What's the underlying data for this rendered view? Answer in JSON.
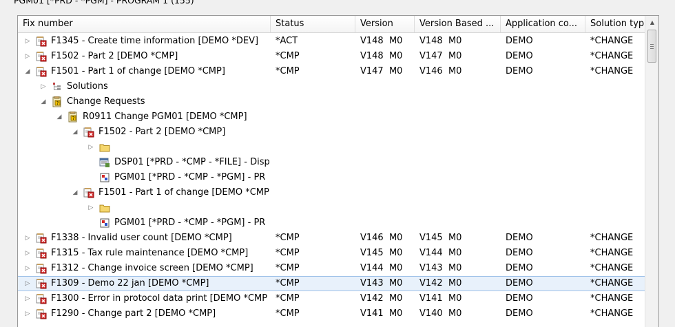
{
  "window": {
    "title": "PGM01 [*PRD - *PGM] - PROGRAM 1 (155)"
  },
  "columns": {
    "fix": "Fix number",
    "status": "Status",
    "version": "Version",
    "based": "Version Based ...",
    "app": "Application co...",
    "sol": "Solution typ"
  },
  "rows": [
    {
      "exp": "right",
      "icon": "fix",
      "indent": 0,
      "name": "F1345 - Create time information [DEMO *DEV]",
      "status": "*ACT",
      "version": "V148  M0",
      "based": "V148  M0",
      "app": "DEMO",
      "sol": "*CHANGE"
    },
    {
      "exp": "right",
      "icon": "fix",
      "indent": 0,
      "name": "F1502 - Part 2 [DEMO *CMP]",
      "status": "*CMP",
      "version": "V148  M0",
      "based": "V147  M0",
      "app": "DEMO",
      "sol": "*CHANGE"
    },
    {
      "exp": "down",
      "icon": "fix",
      "indent": 0,
      "name": "F1501 - Part 1 of change [DEMO *CMP]",
      "status": "*CMP",
      "version": "V147  M0",
      "based": "V146  M0",
      "app": "DEMO",
      "sol": "*CHANGE"
    },
    {
      "exp": "right",
      "icon": "solutions",
      "indent": 1,
      "name": "Solutions",
      "status": "",
      "version": "",
      "based": "",
      "app": "",
      "sol": ""
    },
    {
      "exp": "down",
      "icon": "changereq",
      "indent": 1,
      "name": "Change Requests",
      "status": "",
      "version": "",
      "based": "",
      "app": "",
      "sol": ""
    },
    {
      "exp": "down",
      "icon": "changereq",
      "indent": 2,
      "name": "R0911 Change PGM01 [DEMO *CMP]",
      "status": "",
      "version": "",
      "based": "",
      "app": "",
      "sol": ""
    },
    {
      "exp": "down",
      "icon": "fix",
      "indent": 3,
      "name": "F1502 - Part 2 [DEMO *CMP]",
      "status": "",
      "version": "",
      "based": "",
      "app": "",
      "sol": ""
    },
    {
      "exp": "right",
      "icon": "folder",
      "indent": 4,
      "name": "",
      "status": "",
      "version": "",
      "based": "",
      "app": "",
      "sol": ""
    },
    {
      "exp": "none",
      "icon": "dsp",
      "indent": 4,
      "name": "DSP01 [*PRD - *CMP - *FILE] - Disp",
      "status": "",
      "version": "",
      "based": "",
      "app": "",
      "sol": ""
    },
    {
      "exp": "none",
      "icon": "pgm",
      "indent": 4,
      "name": "PGM01 [*PRD - *CMP - *PGM] - PR",
      "status": "",
      "version": "",
      "based": "",
      "app": "",
      "sol": ""
    },
    {
      "exp": "down",
      "icon": "fix",
      "indent": 3,
      "name": "F1501 - Part 1 of change [DEMO *CMP",
      "status": "",
      "version": "",
      "based": "",
      "app": "",
      "sol": ""
    },
    {
      "exp": "right",
      "icon": "folder",
      "indent": 4,
      "name": "",
      "status": "",
      "version": "",
      "based": "",
      "app": "",
      "sol": ""
    },
    {
      "exp": "none",
      "icon": "pgm",
      "indent": 4,
      "name": "PGM01 [*PRD - *CMP - *PGM] - PR",
      "status": "",
      "version": "",
      "based": "",
      "app": "",
      "sol": ""
    },
    {
      "exp": "right",
      "icon": "fix",
      "indent": 0,
      "name": "F1338 - Invalid user count [DEMO *CMP]",
      "status": "*CMP",
      "version": "V146  M0",
      "based": "V145  M0",
      "app": "DEMO",
      "sol": "*CHANGE"
    },
    {
      "exp": "right",
      "icon": "fix",
      "indent": 0,
      "name": "F1315 - Tax rule maintenance [DEMO *CMP]",
      "status": "*CMP",
      "version": "V145  M0",
      "based": "V144  M0",
      "app": "DEMO",
      "sol": "*CHANGE"
    },
    {
      "exp": "right",
      "icon": "fix",
      "indent": 0,
      "name": "F1312 - Change invoice screen [DEMO *CMP]",
      "status": "*CMP",
      "version": "V144  M0",
      "based": "V143  M0",
      "app": "DEMO",
      "sol": "*CHANGE"
    },
    {
      "exp": "right",
      "icon": "fix",
      "indent": 0,
      "name": "F1309 - Demo 22 jan [DEMO *CMP]",
      "status": "*CMP",
      "version": "V143  M0",
      "based": "V142  M0",
      "app": "DEMO",
      "sol": "*CHANGE",
      "selected": true
    },
    {
      "exp": "right",
      "icon": "fix",
      "indent": 0,
      "name": "F1300 - Error in protocol data print [DEMO *CMP",
      "status": "*CMP",
      "version": "V142  M0",
      "based": "V141  M0",
      "app": "DEMO",
      "sol": "*CHANGE"
    },
    {
      "exp": "right",
      "icon": "fix",
      "indent": 0,
      "name": "F1290 - Change part 2 [DEMO *CMP]",
      "status": "*CMP",
      "version": "V141  M0",
      "based": "V140  M0",
      "app": "DEMO",
      "sol": "*CHANGE"
    }
  ]
}
